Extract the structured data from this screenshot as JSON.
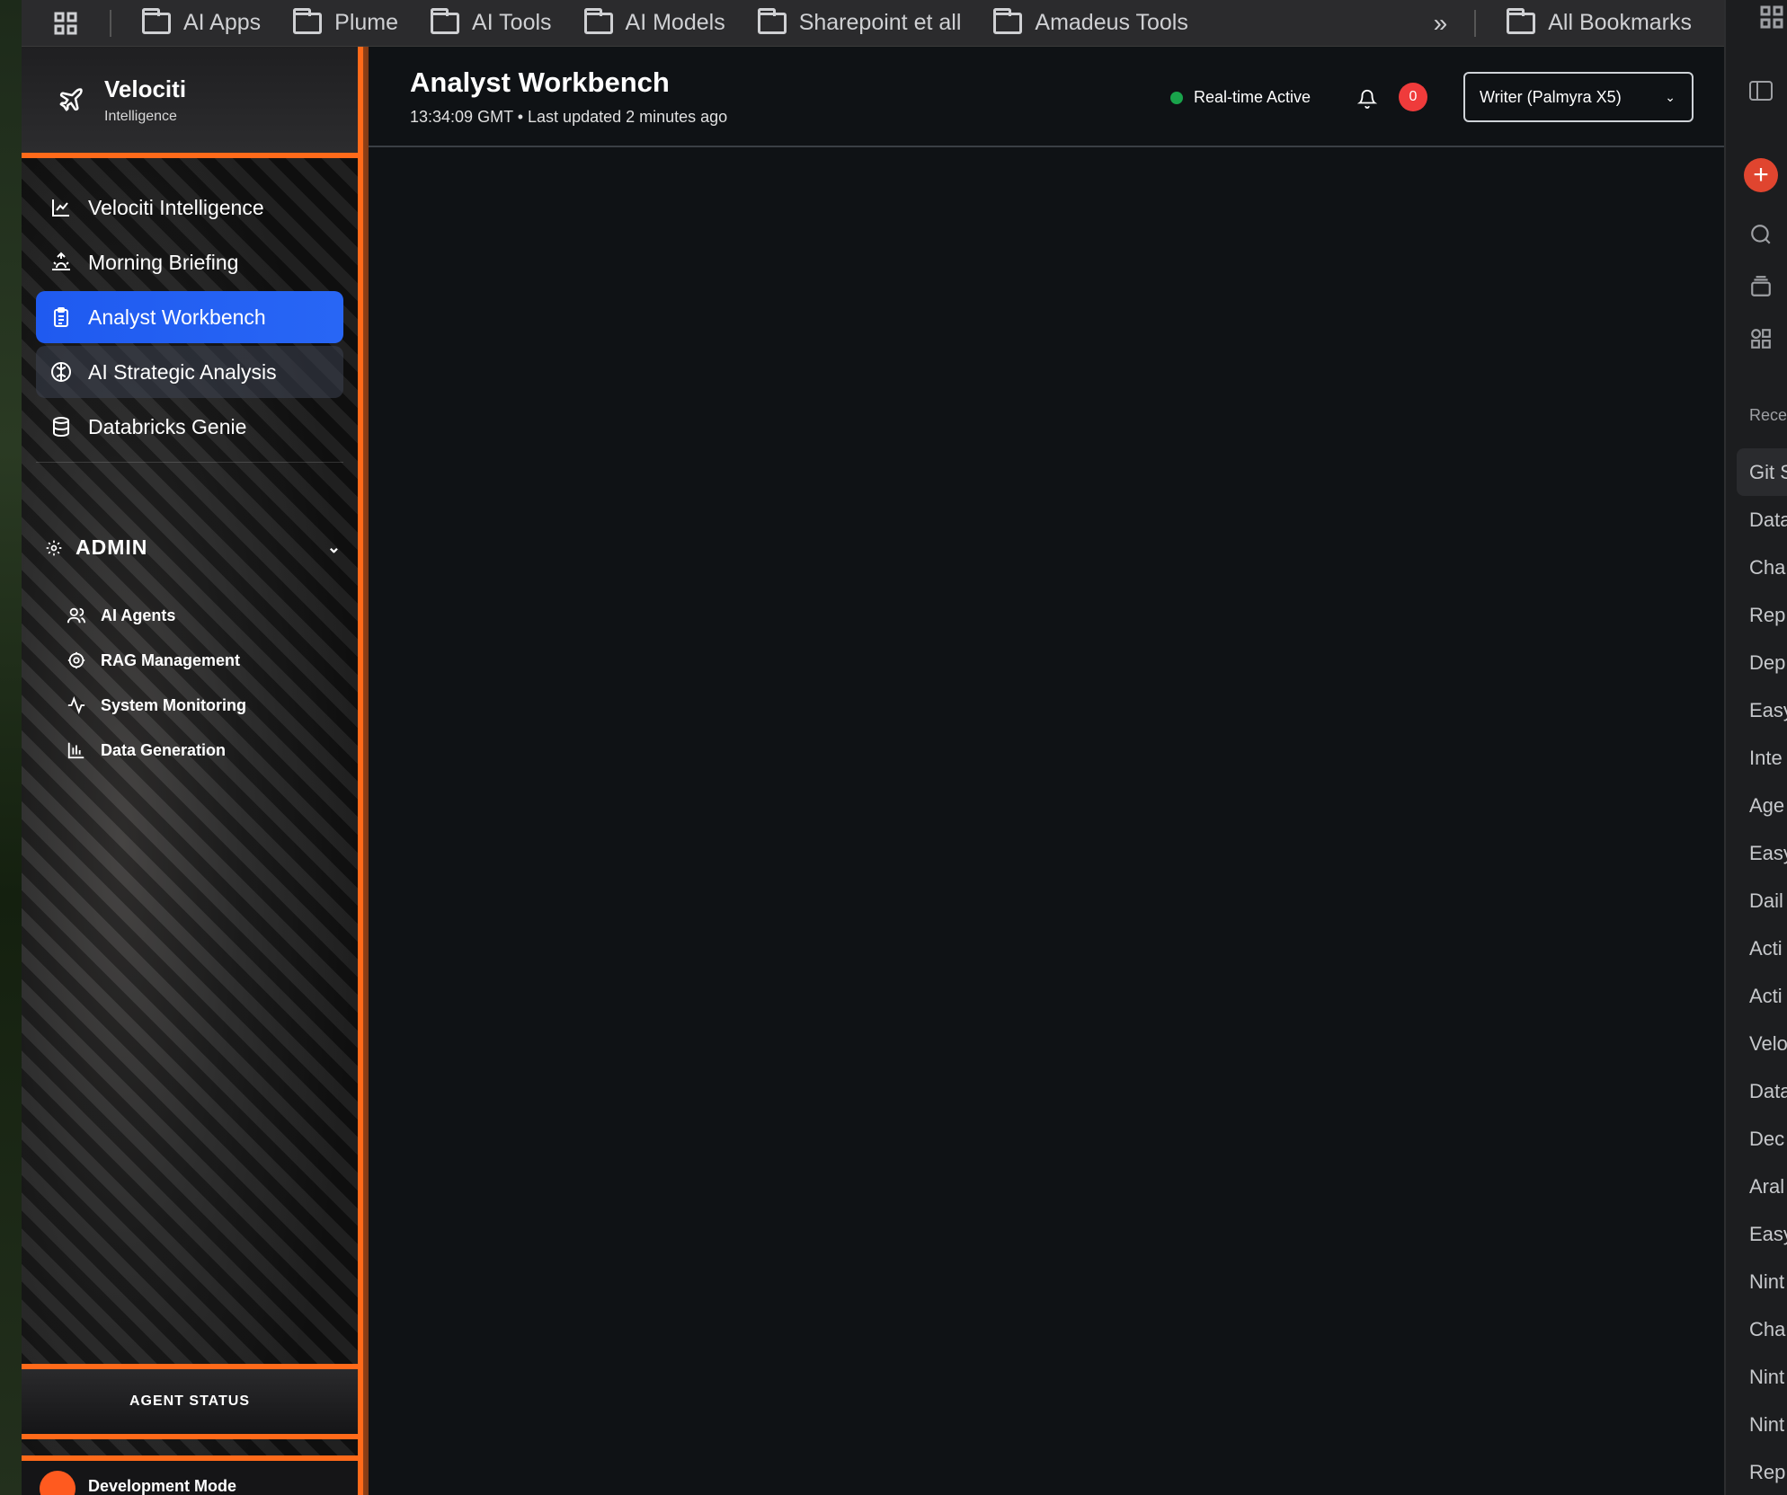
{
  "bookmarks": {
    "items": [
      {
        "label": "AI Apps"
      },
      {
        "label": "Plume"
      },
      {
        "label": "AI Tools"
      },
      {
        "label": "AI Models"
      },
      {
        "label": "Sharepoint et all"
      },
      {
        "label": "Amadeus Tools"
      }
    ],
    "all_label": "All Bookmarks"
  },
  "brand": {
    "name": "Velociti",
    "subtitle": "Intelligence"
  },
  "nav": {
    "items": [
      {
        "label": "Velociti Intelligence",
        "icon": "chart-line-icon"
      },
      {
        "label": "Morning Briefing",
        "icon": "sunrise-icon"
      },
      {
        "label": "Analyst Workbench",
        "icon": "clipboard-icon",
        "active": true
      },
      {
        "label": "AI Strategic Analysis",
        "icon": "brain-icon"
      },
      {
        "label": "Databricks Genie",
        "icon": "database-icon"
      }
    ]
  },
  "admin": {
    "label": "ADMIN",
    "items": [
      {
        "label": "AI Agents",
        "icon": "users-icon"
      },
      {
        "label": "RAG Management",
        "icon": "gear-icon"
      },
      {
        "label": "System Monitoring",
        "icon": "activity-icon"
      },
      {
        "label": "Data Generation",
        "icon": "bar-chart-icon"
      }
    ]
  },
  "agent_status": {
    "label": "AGENT STATUS"
  },
  "dev_mode": {
    "label": "Development Mode"
  },
  "header": {
    "title": "Analyst Workbench",
    "subtitle": "13:34:09 GMT • Last updated 2 minutes ago",
    "status": "Real-time Active",
    "notifications": "0",
    "model_select": "Writer (Palmyra X5)"
  },
  "right_panel": {
    "heading": "Rece",
    "items": [
      "Git S",
      "Data",
      "Cha",
      "Rep",
      "Dep",
      "Easy",
      "Inte",
      "Age",
      "Easy",
      "Dail",
      "Acti",
      "Acti",
      "Velo",
      "Data",
      "Dec",
      "Aral",
      "Easy",
      "Nint",
      "Cha",
      "Nint",
      "Nint",
      "Rep"
    ]
  },
  "colors": {
    "accent": "#ff6a1a",
    "active_nav": "#1f5af0",
    "badge": "#ef3b3b",
    "status_dot": "#19a34b"
  }
}
